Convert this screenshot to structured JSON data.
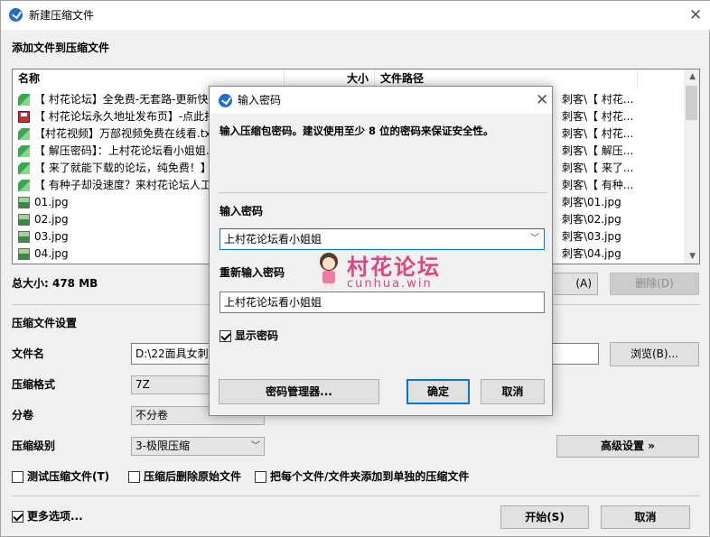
{
  "window": {
    "title": "新建压缩文件",
    "close_glyph": "✕"
  },
  "add_section": {
    "title": "添加文件到压缩文件",
    "columns": {
      "name": "名称",
      "size": "大小",
      "path": "文件路径"
    },
    "files": [
      {
        "name": "【 村花论坛】全免费-无套路-更新快...",
        "path": "刺客\\【 村花...",
        "icon": "green-doc-icon"
      },
      {
        "name": "【 村花论坛永久地址发布页】-点此打...",
        "path": "刺客\\【 村花...",
        "icon": "disk-icon"
      },
      {
        "name": "【村花视频】万部视频免费在线看.txt",
        "path": "刺客\\【 村花...",
        "icon": "green-doc-icon"
      },
      {
        "name": "【 解压密码】：上村花论坛看小姐姐...",
        "path": "刺客\\【 解压...",
        "icon": "green-doc-icon"
      },
      {
        "name": "【 来了就能下载的论坛，纯免费！】",
        "path": "刺客\\【 来了...",
        "icon": "green-doc-icon"
      },
      {
        "name": "【 有种子却没速度？来村花论坛人工...",
        "path": "刺客\\【 有种...",
        "icon": "green-doc-icon"
      },
      {
        "name": "01.jpg",
        "path": "刺客\\01.jpg",
        "icon": "image-icon"
      },
      {
        "name": "02.jpg",
        "path": "刺客\\02.jpg",
        "icon": "image-icon"
      },
      {
        "name": "03.jpg",
        "path": "刺客\\03.jpg",
        "icon": "image-icon"
      },
      {
        "name": "04.jpg",
        "path": "刺客\\04.jpg",
        "icon": "image-icon"
      }
    ],
    "total_size": "总大小: 478 MB",
    "add_button_partial": "(A)",
    "delete_button": "删除(D)"
  },
  "settings": {
    "title": "压缩文件设置",
    "filename_label": "文件名",
    "filename_value": "D:\\22面具女刺客",
    "browse_button": "浏览(B)...",
    "format_label": "压缩格式",
    "format_value": "7Z",
    "split_label": "分卷",
    "split_value": "不分卷",
    "level_label": "压缩级别",
    "level_value": "3-极限压缩",
    "advanced_button": "高级设置 »",
    "test_checkbox": "测试压缩文件(T)",
    "delete_after_checkbox": "压缩后删除原始文件",
    "separate_checkbox": "把每个文件/文件夹添加到单独的压缩文件",
    "more_options": "更多选项...",
    "start_button": "开始(S)",
    "cancel_button": "取消"
  },
  "password_dialog": {
    "title": "输入密码",
    "description": "输入压缩包密码。建议使用至少 8 位的密码来保证安全性。",
    "password_label": "输入密码",
    "password_value": "上村花论坛看小姐姐",
    "repeat_label": "重新输入密码",
    "repeat_value": "上村花论坛看小姐姐",
    "show_password": "显示密码",
    "manager_button": "密码管理器...",
    "ok_button": "确定",
    "cancel_button": "取消"
  },
  "watermark": {
    "text": "村花论坛",
    "sub": "cunhua.win"
  },
  "colors": {
    "accent": "#0078d7",
    "watermark": "#e0447c"
  }
}
